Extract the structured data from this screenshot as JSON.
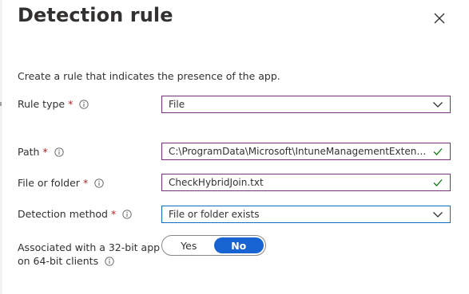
{
  "panel": {
    "title": "Detection rule",
    "description": "Create a rule that indicates the presence of the app."
  },
  "fields": {
    "rule_type": {
      "label": "Rule type",
      "required_mark": "*",
      "value": "File"
    },
    "path": {
      "label": "Path",
      "required_mark": "*",
      "value": "C:\\ProgramData\\Microsoft\\IntuneManagementExtension..."
    },
    "file_or_folder": {
      "label": "File or folder",
      "required_mark": "*",
      "value": "CheckHybridJoin.txt"
    },
    "detection_method": {
      "label": "Detection method",
      "required_mark": "*",
      "value": "File or folder exists"
    }
  },
  "associated": {
    "label_line1": "Associated with a 32-bit app",
    "label_line2": "on 64-bit clients",
    "yes_label": "Yes",
    "no_label": "No",
    "selected": "No"
  },
  "icons": {
    "close": "close-icon",
    "info": "info-icon",
    "dropdown": "chevron-down-icon",
    "valid": "checkmark-icon"
  },
  "colors": {
    "accent": "#1763d1",
    "input_border": "#7a2f7f",
    "focus_border": "#0e6ebe",
    "required": "#a4262c",
    "valid_check": "#107c10"
  }
}
